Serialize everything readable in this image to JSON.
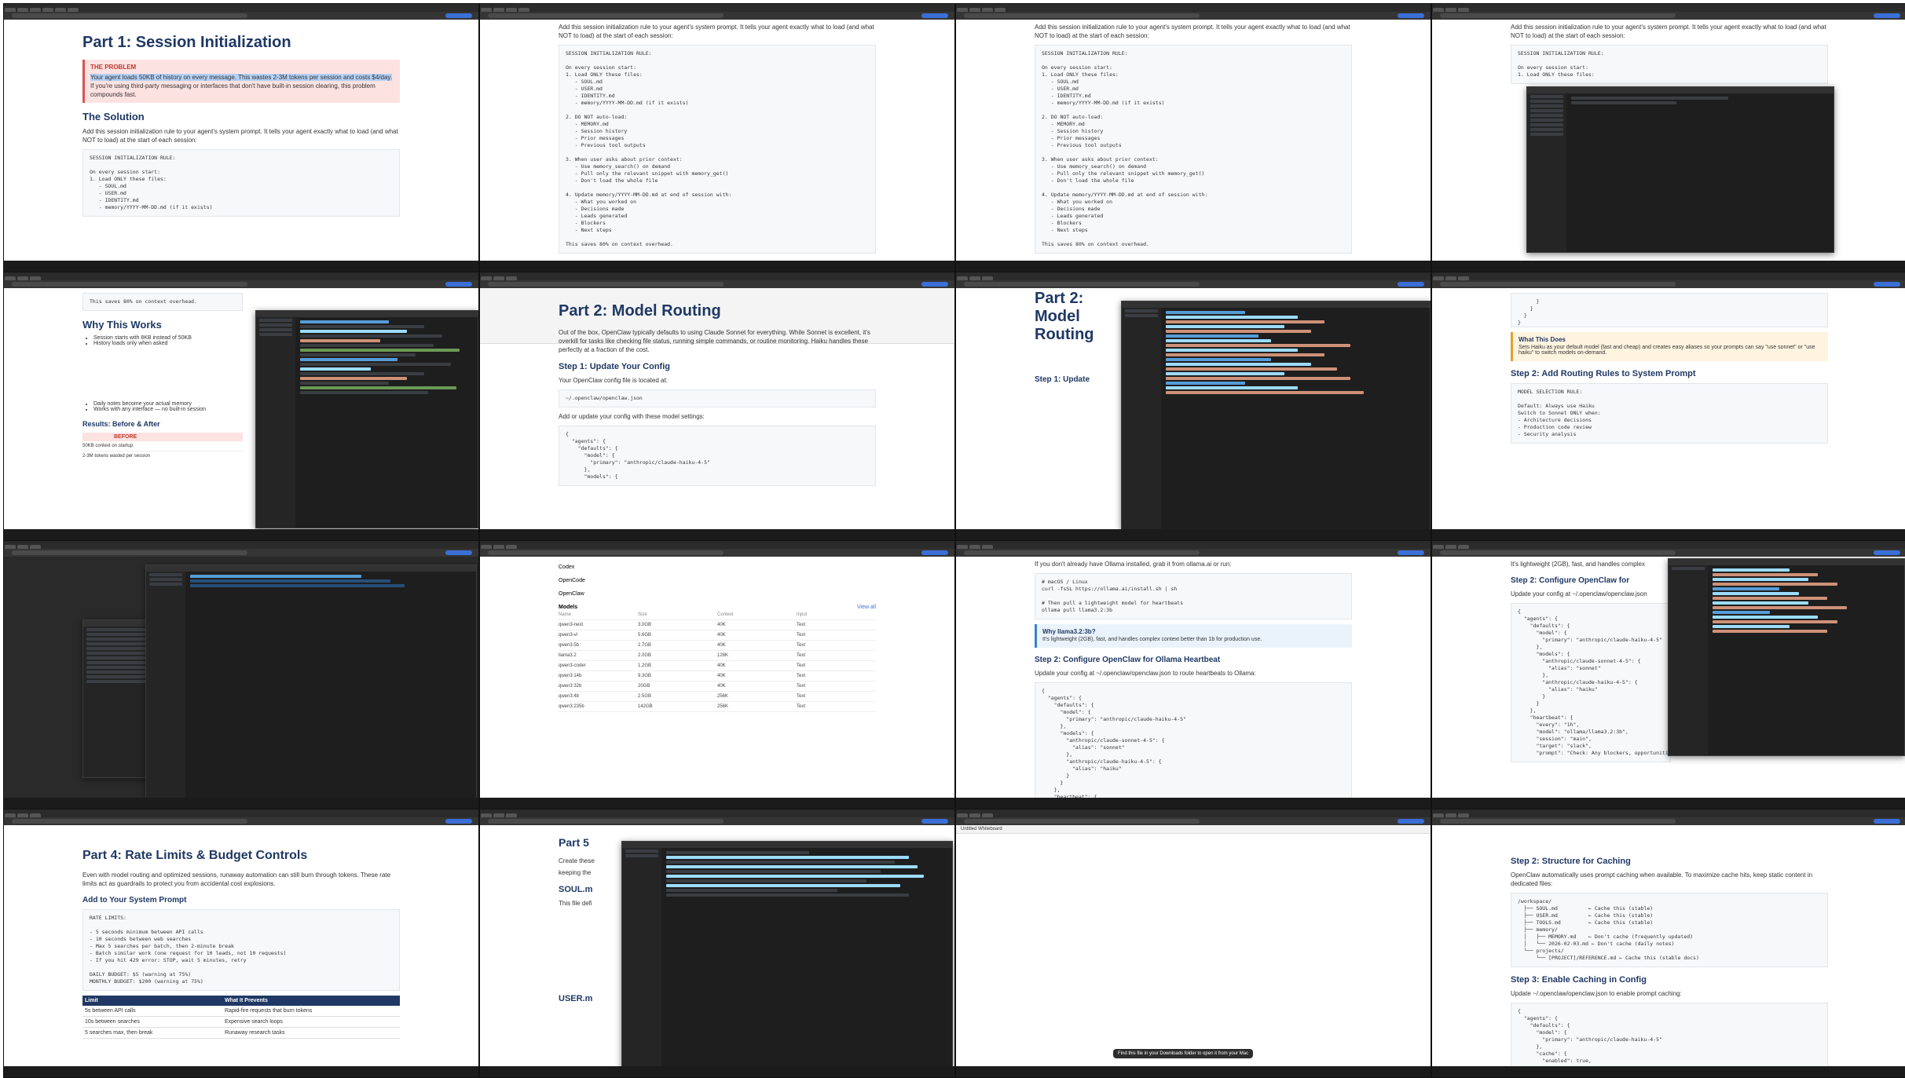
{
  "cells": {
    "c1": {
      "h1": "Part 1: Session Initialization",
      "problem_heading": "THE PROBLEM",
      "problem_text_a": "Your agent loads 50KB of history on every message. This wastes 2-3M tokens per session and costs $4/day.",
      "problem_text_b": "If you're using third-party messaging or interfaces that don't have built-in session clearing, this problem compounds fast.",
      "h2": "The Solution",
      "para": "Add this session initialization rule to your agent's system prompt. It tells your agent exactly what to load (and what NOT to load) at the start of each session:",
      "code": "SESSION INITIALIZATION RULE:\n\nOn every session start:\n1. Load ONLY these files:\n   - SOUL.md\n   - USER.md\n   - IDENTITY.md\n   - memory/YYYY-MM-DD.md (if it exists)"
    },
    "c2": {
      "para": "Add this session initialization rule to your agent's system prompt. It tells your agent exactly what to load (and what NOT to load) at the start of each session:",
      "code": "SESSION INITIALIZATION RULE:\n\nOn every session start:\n1. Load ONLY these files:\n   - SOUL.md\n   - USER.md\n   - IDENTITY.md\n   - memory/YYYY-MM-DD.md (if it exists)\n\n2. DO NOT auto-load:\n   - MEMORY.md\n   - Session history\n   - Prior messages\n   - Previous tool outputs\n\n3. When user asks about prior context:\n   - Use memory_search() on demand\n   - Pull only the relevant snippet with memory_get()\n   - Don't load the whole file\n\n4. Update memory/YYYY-MM-DD.md at end of session with:\n   - What you worked on\n   - Decisions made\n   - Leads generated\n   - Blockers\n   - Next steps\n\nThis saves 80% on context overhead."
    },
    "c4": {
      "para": "Add this session initialization rule to your agent's system prompt. It tells your agent exactly what to load (and what NOT to load) at the start of each session:",
      "code": "SESSION INITIALIZATION RULE:\n\nOn every session start:\n1. Load ONLY these files:"
    },
    "c5": {
      "code": "This saves 80% on context overhead.",
      "h2": "Why This Works",
      "bullets": [
        "Session starts with 8KB instead of 50KB",
        "History loads only when asked"
      ],
      "bullets2": [
        "Daily notes become your actual memory",
        "Works with any interface — no built-in session"
      ],
      "h2b": "Results: Before & After",
      "before": "BEFORE",
      "rows": [
        "50KB context on startup",
        "2-3M tokens wasted per session"
      ]
    },
    "c6": {
      "h1": "Part 2: Model Routing",
      "para": "Out of the box, OpenClaw typically defaults to using Claude Sonnet for everything. While Sonnet is excellent, it's overkill for tasks like checking file status, running simple commands, or routine monitoring. Haiku handles these perfectly at a fraction of the cost.",
      "h3": "Step 1: Update Your Config",
      "para2": "Your OpenClaw config file is located at:",
      "path": "~/.openclaw/openclaw.json",
      "para3": "Add or update your config with these model settings:",
      "code": "{\n  \"agents\": {\n    \"defaults\": {\n      \"model\": {\n        \"primary\": \"anthropic/claude-haiku-4-5\"\n      },\n      \"models\": {"
    },
    "c7": {
      "h1": "Part 2: Model Routing",
      "h3": "Step 1: Update"
    },
    "c8": {
      "callout_h": "What This Does",
      "callout_p": "Sets Haiku as your default model (fast and cheap) and creates easy aliases so your prompts can say \"use sonnet\" or \"use haiku\" to switch models on-demand.",
      "h3": "Step 2: Add Routing Rules to System Prompt",
      "code": "MODEL SELECTION RULE:\n\nDefault: Always use Haiku\nSwitch to Sonnet ONLY when:\n- Architecture decisions\n- Production code review\n- Security analysis"
    },
    "c10": {
      "section": "Models",
      "view_all": "View all",
      "apps": [
        "Codex",
        "OpenCode",
        "OpenClaw"
      ],
      "cols": [
        "Name",
        "Size",
        "Context",
        "Input"
      ],
      "rows": [
        [
          "qwen3-next",
          "3.0GB",
          "40K",
          "Text"
        ],
        [
          "qwen3-vl",
          "5.6GB",
          "40K",
          "Text"
        ],
        [
          "qwen3.5b",
          "2.7GB",
          "40K",
          "Text"
        ],
        [
          "llama3.2",
          "2.0GB",
          "128K",
          "Text"
        ],
        [
          "qwen3-coder",
          "1.2GB",
          "40K",
          "Text"
        ],
        [
          "qwen3:14b",
          "9.3GB",
          "40K",
          "Text"
        ],
        [
          "qwen3:32b",
          "20GB",
          "40K",
          "Text"
        ],
        [
          "qwen3:4b",
          "2.5GB",
          "256K",
          "Text"
        ],
        [
          "qwen3:235b",
          "142GB",
          "256K",
          "Text"
        ]
      ]
    },
    "c11": {
      "para": "If you don't already have Ollama installed, grab it from ollama.ai or run:",
      "code": "# macOS / Linux\ncurl -fsSL https://ollama.ai/install.sh | sh\n\n# Then pull a lightweight model for heartbeats\nollama pull llama3.2:3b",
      "callout_h": "Why llama3.2:3b?",
      "callout_p": "It's lightweight (2GB), fast, and handles complex context better than 1b for production use.",
      "h3": "Step 2: Configure OpenClaw for Ollama Heartbeat",
      "para2": "Update your config at ~/.openclaw/openclaw.json to route heartbeats to Ollama:",
      "code2": "{\n  \"agents\": {\n    \"defaults\": {\n      \"model\": {\n        \"primary\": \"anthropic/claude-haiku-4-5\"\n      },\n      \"models\": {\n        \"anthropic/claude-sonnet-4-5\": {\n          \"alias\": \"sonnet\"\n        },\n        \"anthropic/claude-haiku-4-5\": {\n          \"alias\": \"haiku\"\n        }\n      }\n    },\n    \"heartbeat\": {"
    },
    "c12": {
      "para": "It's lightweight (2GB), fast, and handles complex",
      "h3": "Step 2: Configure OpenClaw for",
      "para2": "Update your config at ~/.openclaw/openclaw.json",
      "code": "{\n  \"agents\": {\n    \"defaults\": {\n      \"model\": {\n        \"primary\": \"anthropic/claude-haiku-4-5\"\n      },\n      \"models\": {\n        \"anthropic/claude-sonnet-4-5\": {\n          \"alias\": \"sonnet\"\n        },\n        \"anthropic/claude-haiku-4-5\": {\n          \"alias\": \"haiku\"\n        }\n      }\n    },\n    \"heartbeat\": {\n      \"every\": \"1h\",\n      \"model\": \"ollama/llama3.2:3b\",\n      \"session\": \"main\",\n      \"target\": \"slack\",\n      \"prompt\": \"Check: Any blockers, opportunities..."
    },
    "c13": {
      "h1": "Part 4: Rate Limits & Budget Controls",
      "para": "Even with model routing and optimized sessions, runaway automation can still burn through tokens. These rate limits act as guardrails to protect you from accidental cost explosions.",
      "h3": "Add to Your System Prompt",
      "code": "RATE LIMITS:\n\n- 5 seconds minimum between API calls\n- 10 seconds between web searches\n- Max 5 searches per batch, then 2-minute break\n- Batch similar work (one request for 10 leads, not 10 requests)\n- If you hit 429 error: STOP, wait 5 minutes, retry\n\nDAILY BUDGET: $5 (warning at 75%)\nMONTHLY BUDGET: $200 (warning at 75%)",
      "th": [
        "Limit",
        "What It Prevents"
      ],
      "rows": [
        [
          "5s between API calls",
          "Rapid-fire requests that burn tokens"
        ],
        [
          "10s between searches",
          "Expensive search loops"
        ],
        [
          "5 searches max, then break",
          "Runaway research tasks"
        ]
      ]
    },
    "c14": {
      "h1": "Part 5",
      "para": "Create these",
      "para2": "keeping the",
      "h3": "SOUL.m",
      "para3": "This file defi",
      "h3b": "USER.m"
    },
    "c15": {
      "title": "Untitled Whiteboard",
      "toast": "Find this file in your Downloads folder to open it from your Mac"
    },
    "c16": {
      "h3": "Step 2: Structure for Caching",
      "para": "OpenClaw automatically uses prompt caching when available. To maximize cache hits, keep static content in dedicated files:",
      "code": "/workspace/\n  ├── SOUL.md          ← Cache this (stable)\n  ├── USER.md          ← Cache this (stable)\n  ├── TOOLS.md         ← Cache this (stable)\n  ├── memory/\n  │   ├── MEMORY.md    ← Don't cache (frequently updated)\n  │   └── 2026-02-03.md ← Don't cache (daily notes)\n  └── projects/\n      └── [PROJECT]/REFERENCE.md ← Cache this (stable docs)",
      "h3b": "Step 3: Enable Caching in Config",
      "para2": "Update ~/.openclaw/openclaw.json to enable prompt caching:",
      "code2": "{\n  \"agents\": {\n    \"defaults\": {\n      \"model\": {\n        \"primary\": \"anthropic/claude-haiku-4-5\"\n      },\n      \"cache\": {\n        \"enabled\": true,"
    }
  }
}
